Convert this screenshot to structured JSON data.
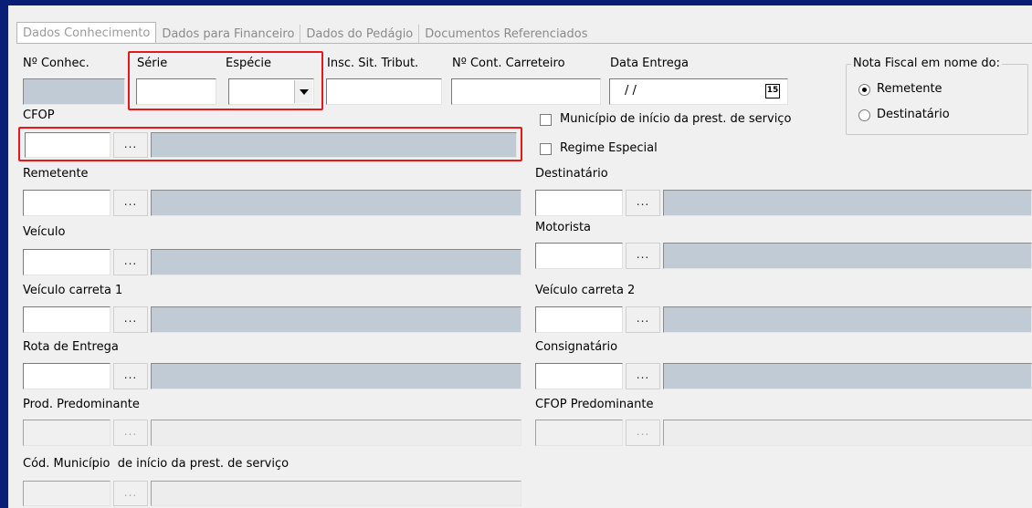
{
  "tabs": [
    "Dados Conhecimento",
    "Dados para Financeiro",
    "Dados do Pedágio",
    "Documentos Referenciados"
  ],
  "labels": {
    "num_conhec": "Nº Conhec.",
    "serie": "Série",
    "especie": "Espécie",
    "insc_sit_tribut": "Insc. Sit. Tribut.",
    "num_cont_carreteiro": "Nº Cont. Carreteiro",
    "data_entrega": "Data Entrega",
    "cfop": "CFOP",
    "remetente": "Remetente",
    "destinatario": "Destinatário",
    "veiculo": "Veículo",
    "motorista": "Motorista",
    "veiculo_carreta_1": "Veículo carreta 1",
    "veiculo_carreta_2": "Veículo carreta 2",
    "rota_entrega": "Rota de Entrega",
    "consignatario": "Consignatário",
    "prod_predominante": "Prod. Predominante",
    "cfop_predominante": "CFOP Predominante",
    "cod_municipio": "Cód. Município  de início da prest. de serviço"
  },
  "values": {
    "data_entrega": "/ /",
    "calendar_icon_text": "15"
  },
  "checkboxes": {
    "municipio_inicio": "Município de início da prest. de serviço",
    "regime_especial": "Regime Especial"
  },
  "nota_fiscal_group": {
    "title": "Nota Fiscal em nome do:",
    "options": [
      "Remetente",
      "Destinatário"
    ],
    "selected": "Remetente"
  },
  "lookup_button_label": "...",
  "colors": {
    "highlight": "#e81818",
    "readonly_field": "#c0cbd6",
    "window_border": "#0a1e78"
  }
}
